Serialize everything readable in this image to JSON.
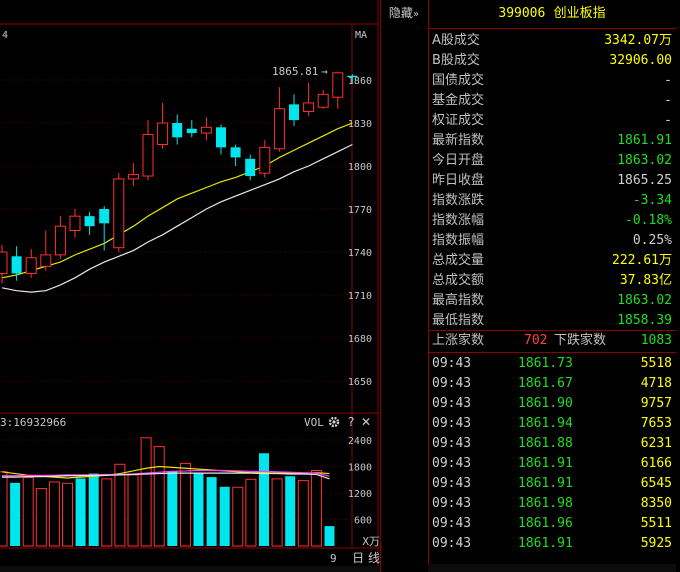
{
  "header": {
    "hide_label": "隐藏",
    "hide_icon": "double-chevron-right-icon",
    "code": "399006",
    "name": "创业板指"
  },
  "kline": {
    "corner_digit": "4",
    "ma_label": "MA",
    "high_marker": "1865.81",
    "y_ticks": [
      "1860",
      "1830",
      "1800",
      "1770",
      "1740",
      "1710",
      "1680",
      "1650"
    ],
    "candles": [
      {
        "o": 1725,
        "c": 1740,
        "h": 1745,
        "l": 1718
      },
      {
        "o": 1737,
        "c": 1725,
        "h": 1744,
        "l": 1720
      },
      {
        "o": 1725,
        "c": 1736,
        "h": 1742,
        "l": 1722
      },
      {
        "o": 1730,
        "c": 1738,
        "h": 1755,
        "l": 1727
      },
      {
        "o": 1738,
        "c": 1758,
        "h": 1765,
        "l": 1735
      },
      {
        "o": 1755,
        "c": 1765,
        "h": 1770,
        "l": 1750
      },
      {
        "o": 1765,
        "c": 1758,
        "h": 1768,
        "l": 1752
      },
      {
        "o": 1770,
        "c": 1760,
        "h": 1772,
        "l": 1741
      },
      {
        "o": 1743,
        "c": 1791,
        "h": 1795,
        "l": 1740
      },
      {
        "o": 1791,
        "c": 1794,
        "h": 1802,
        "l": 1786
      },
      {
        "o": 1793,
        "c": 1822,
        "h": 1832,
        "l": 1790
      },
      {
        "o": 1815,
        "c": 1830,
        "h": 1844,
        "l": 1812
      },
      {
        "o": 1830,
        "c": 1820,
        "h": 1836,
        "l": 1815
      },
      {
        "o": 1826,
        "c": 1823,
        "h": 1832,
        "l": 1820
      },
      {
        "o": 1823,
        "c": 1827,
        "h": 1834,
        "l": 1818
      },
      {
        "o": 1827,
        "c": 1813,
        "h": 1829,
        "l": 1808
      },
      {
        "o": 1813,
        "c": 1806,
        "h": 1815,
        "l": 1800
      },
      {
        "o": 1805,
        "c": 1793,
        "h": 1808,
        "l": 1790
      },
      {
        "o": 1795,
        "c": 1813,
        "h": 1818,
        "l": 1792
      },
      {
        "o": 1812,
        "c": 1840,
        "h": 1855,
        "l": 1810
      },
      {
        "o": 1843,
        "c": 1832,
        "h": 1850,
        "l": 1828
      },
      {
        "o": 1838,
        "c": 1844,
        "h": 1858,
        "l": 1835
      },
      {
        "o": 1841,
        "c": 1850,
        "h": 1853,
        "l": 1840
      },
      {
        "o": 1848,
        "c": 1865,
        "h": 1866,
        "l": 1840
      },
      {
        "o": 1863,
        "c": 1862,
        "h": 1864,
        "l": 1858
      }
    ],
    "ma_yellow": [
      1722,
      1724,
      1727,
      1730,
      1733,
      1738,
      1742,
      1746,
      1752,
      1758,
      1765,
      1771,
      1777,
      1781,
      1785,
      1789,
      1792,
      1796,
      1800,
      1806,
      1811,
      1816,
      1821,
      1826,
      1830
    ],
    "ma_white": [
      1715,
      1713,
      1712,
      1713,
      1717,
      1722,
      1728,
      1733,
      1737,
      1741,
      1747,
      1752,
      1758,
      1764,
      1770,
      1775,
      1779,
      1783,
      1787,
      1791,
      1796,
      1800,
      1805,
      1810,
      1815
    ]
  },
  "volume": {
    "header_value": "3:16932966",
    "vol_label": "VOL",
    "gear_icon": "gear-icon",
    "help_icon": "question-icon",
    "close_icon": "close-icon",
    "y_ticks": [
      "2400",
      "1800",
      "1200",
      "600"
    ],
    "unit": "X万",
    "last_label": "9",
    "bars": [
      1680,
      1430,
      1550,
      1300,
      1450,
      1420,
      1530,
      1640,
      1520,
      1850,
      1610,
      2450,
      2250,
      1690,
      1870,
      1650,
      1560,
      1340,
      1330,
      1510,
      2100,
      1520,
      1580,
      1480,
      1710,
      450
    ],
    "bar_up": [
      true,
      false,
      true,
      true,
      true,
      true,
      false,
      false,
      true,
      true,
      true,
      true,
      true,
      false,
      true,
      false,
      false,
      false,
      true,
      true,
      false,
      true,
      false,
      true,
      true,
      false
    ],
    "line_yellow": [
      1680,
      1640,
      1600,
      1580,
      1560,
      1540,
      1560,
      1580,
      1600,
      1640,
      1700,
      1760,
      1800,
      1780,
      1760,
      1740,
      1720,
      1700,
      1680,
      1660,
      1660,
      1650,
      1650,
      1640,
      1660,
      1640
    ],
    "line_magenta": [
      1590,
      1590,
      1600,
      1600,
      1600,
      1610,
      1610,
      1610,
      1620,
      1620,
      1630,
      1650,
      1670,
      1690,
      1700,
      1710,
      1710,
      1710,
      1700,
      1690,
      1690,
      1680,
      1670,
      1660,
      1650,
      1580
    ],
    "line_white": [
      1560,
      1560,
      1570,
      1570,
      1580,
      1590,
      1590,
      1600,
      1600,
      1610,
      1620,
      1630,
      1640,
      1650,
      1650,
      1650,
      1650,
      1650,
      1650,
      1650,
      1640,
      1640,
      1630,
      1630,
      1620,
      1520
    ]
  },
  "bottom": {
    "day_label": "日 线"
  },
  "stats": [
    {
      "label": "A股成交",
      "value": "3342.07万",
      "cls": "yl"
    },
    {
      "label": "B股成交",
      "value": "32906.00",
      "cls": "yl"
    },
    {
      "label": "国债成交",
      "value": "-",
      "cls": "wh"
    },
    {
      "label": "基金成交",
      "value": "-",
      "cls": "wh"
    },
    {
      "label": "权证成交",
      "value": "-",
      "cls": "wh"
    },
    {
      "label": "最新指数",
      "value": "1861.91",
      "cls": "dn"
    },
    {
      "label": "今日开盘",
      "value": "1863.02",
      "cls": "dn"
    },
    {
      "label": "昨日收盘",
      "value": "1865.25",
      "cls": "wh"
    },
    {
      "label": "指数涨跌",
      "value": "-3.34",
      "cls": "dn"
    },
    {
      "label": "指数涨幅",
      "value": "-0.18%",
      "cls": "dn"
    },
    {
      "label": "指数振幅",
      "value": "0.25%",
      "cls": "wh"
    },
    {
      "label": "总成交量",
      "value": "222.61万",
      "cls": "yl"
    },
    {
      "label": "总成交额",
      "value": "37.83亿",
      "cls": "yl"
    },
    {
      "label": "最高指数",
      "value": "1863.02",
      "cls": "dn"
    },
    {
      "label": "最低指数",
      "value": "1858.39",
      "cls": "dn"
    }
  ],
  "breadth": {
    "up_label": "上涨家数",
    "up_value": "702",
    "down_label": "下跌家数",
    "down_value": "1083"
  },
  "ticks": [
    {
      "time": "09:43",
      "price": "1861.73",
      "vol": "5518"
    },
    {
      "time": "09:43",
      "price": "1861.67",
      "vol": "4718"
    },
    {
      "time": "09:43",
      "price": "1861.90",
      "vol": "9757"
    },
    {
      "time": "09:43",
      "price": "1861.94",
      "vol": "7653"
    },
    {
      "time": "09:43",
      "price": "1861.88",
      "vol": "6231"
    },
    {
      "time": "09:43",
      "price": "1861.91",
      "vol": "6166"
    },
    {
      "time": "09:43",
      "price": "1861.91",
      "vol": "6545"
    },
    {
      "time": "09:43",
      "price": "1861.98",
      "vol": "8350"
    },
    {
      "time": "09:43",
      "price": "1861.96",
      "vol": "5511"
    },
    {
      "time": "09:43",
      "price": "1861.91",
      "vol": "5925"
    }
  ]
}
